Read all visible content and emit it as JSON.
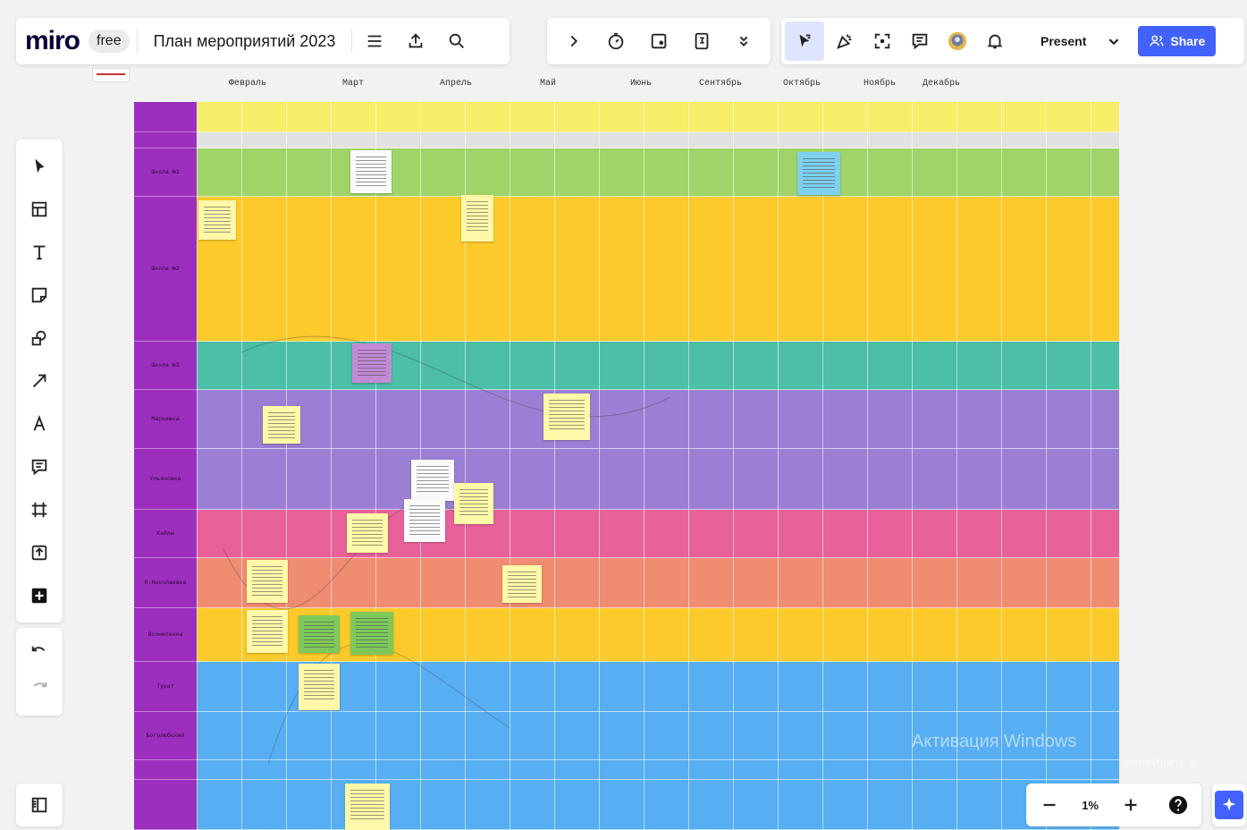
{
  "app": {
    "logo": "miro",
    "plan": "free",
    "board_title": "План мероприятий 2023"
  },
  "toolbar": {
    "present_label": "Present",
    "share_label": "Share"
  },
  "months": [
    "Февраль",
    "Март",
    "Апрель",
    "Май",
    "Июнь",
    "Сентябрь",
    "Октябрь",
    "Ноябрь",
    "Декабрь"
  ],
  "rows": [
    "Школа №1",
    "Школа №2",
    "Школа №3",
    "Марьевка",
    "Ульяновка",
    "Кайлы",
    "Н-Николаевка",
    "Вознесенка",
    "Турат",
    "Боголюбский"
  ],
  "zoom": {
    "level": "1%"
  },
  "watermark": {
    "title": "Активация Windows",
    "subtitle": "перейдите в"
  },
  "colors": {
    "header": "#f7ee6a",
    "grey": "#e2e2e2",
    "green": "#a0d468",
    "orange": "#fcca2b",
    "teal": "#4cbfa6",
    "violet": "#9b7fd4",
    "pink": "#e8619a",
    "salmon": "#f08c72",
    "blue": "#57aef2",
    "label": "#9d2fbf",
    "accent": "#4262ff"
  }
}
